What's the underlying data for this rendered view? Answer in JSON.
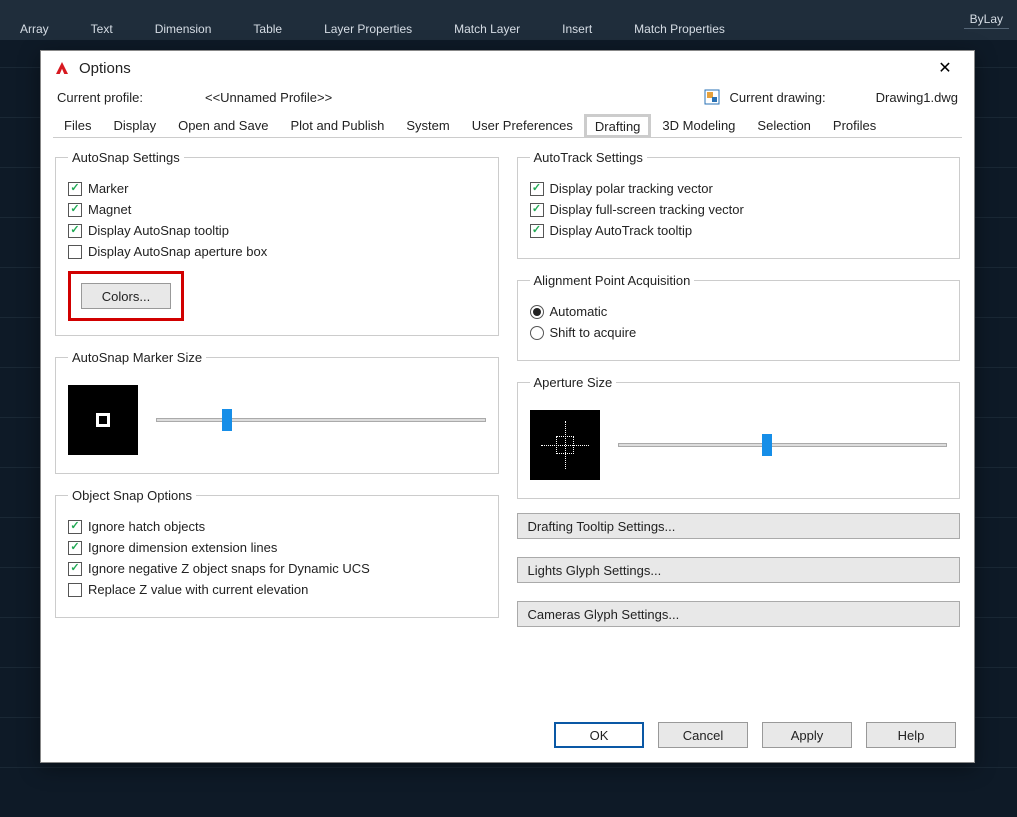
{
  "background_ribbon": {
    "items": [
      "Array",
      "Text",
      "Dimension",
      "Table",
      "Layer Properties",
      "Match Layer",
      "Insert",
      "Match Properties"
    ],
    "bylayer": "ByLay"
  },
  "dialog": {
    "title": "Options",
    "profile_label": "Current profile:",
    "profile_value": "<<Unnamed Profile>>",
    "drawing_label": "Current drawing:",
    "drawing_value": "Drawing1.dwg",
    "close": "✕"
  },
  "tabs": [
    "Files",
    "Display",
    "Open and Save",
    "Plot and Publish",
    "System",
    "User Preferences",
    "Drafting",
    "3D Modeling",
    "Selection",
    "Profiles"
  ],
  "active_tab_index": 6,
  "left": {
    "autosnap": {
      "legend": "AutoSnap Settings",
      "marker": "Marker",
      "magnet": "Magnet",
      "tooltip": "Display AutoSnap tooltip",
      "aperture": "Display AutoSnap aperture box",
      "colors_btn": "Colors..."
    },
    "marker_size": {
      "legend": "AutoSnap Marker Size"
    },
    "osnap": {
      "legend": "Object Snap Options",
      "hatch": "Ignore hatch objects",
      "dimext": "Ignore dimension extension lines",
      "negz": "Ignore negative Z object snaps for Dynamic UCS",
      "replacez": "Replace Z value with current elevation"
    }
  },
  "right": {
    "autotrack": {
      "legend": "AutoTrack Settings",
      "polar": "Display polar tracking vector",
      "fullscreen": "Display full-screen tracking vector",
      "tooltip": "Display AutoTrack tooltip"
    },
    "alignment": {
      "legend": "Alignment Point Acquisition",
      "auto": "Automatic",
      "shift": "Shift to acquire"
    },
    "aperture_size": {
      "legend": "Aperture Size"
    },
    "btn_drafting_tooltip": "Drafting Tooltip Settings...",
    "btn_lights_glyph": "Lights Glyph Settings...",
    "btn_cameras_glyph": "Cameras Glyph Settings..."
  },
  "footer": {
    "ok": "OK",
    "cancel": "Cancel",
    "apply": "Apply",
    "help": "Help"
  }
}
